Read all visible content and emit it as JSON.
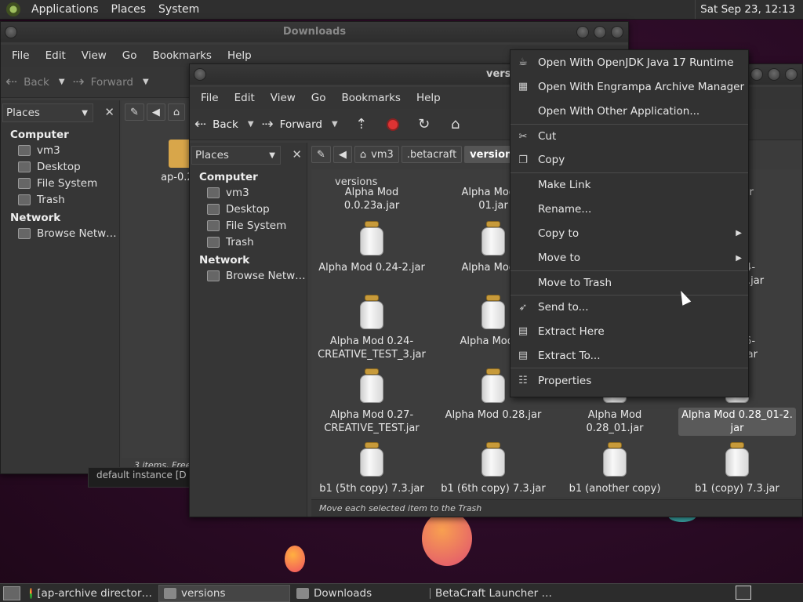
{
  "topbar": {
    "menus": [
      "Applications",
      "Places",
      "System"
    ],
    "clock": "Sat Sep 23, 12:13"
  },
  "back_window": {
    "title": "Downloads",
    "menus": [
      "File",
      "Edit",
      "View",
      "Go",
      "Bookmarks",
      "Help"
    ],
    "back_label": "Back",
    "forward_label": "Forward",
    "places_label": "Places",
    "sidebar": {
      "computer": "Computer",
      "items": [
        "vm3",
        "Desktop",
        "File System",
        "Trash"
      ],
      "network": "Network",
      "net_items": [
        "Browse Netw…"
      ]
    },
    "file": "ap-0.28",
    "status": "3 items, Free s",
    "behind_text": "default instance [D"
  },
  "front_window": {
    "title": "versi",
    "menus": [
      "File",
      "Edit",
      "View",
      "Go",
      "Bookmarks",
      "Help"
    ],
    "back_label": "Back",
    "forward_label": "Forward",
    "places_label": "Places",
    "path": [
      "vm3",
      ".betacraft",
      "versions"
    ],
    "sidebar": {
      "computer": "Computer",
      "items": [
        "vm3",
        "Desktop",
        "File System",
        "Trash"
      ],
      "network": "Network",
      "net_items": [
        "Browse Netw…"
      ]
    },
    "folder_header": "versions",
    "files": [
      {
        "name": "Alpha Mod 0.0.23a.jar"
      },
      {
        "name": "Alpha Mod 0\n01.jar"
      },
      {
        "name": ".24.jar"
      },
      {
        "name": "Alpha Mod 0.24-2.jar"
      },
      {
        "name": "Alpha Mod 0"
      },
      {
        "name": "d 0.24-\nTEST_2.jar"
      },
      {
        "name": "Alpha Mod 0.24-\nCREATIVE_TEST_3.jar"
      },
      {
        "name": "Alpha Mod 0."
      },
      {
        "name": "d 0.26-\nTEST.jar"
      },
      {
        "name": "Alpha Mod 0.27-\nCREATIVE_TEST.jar"
      },
      {
        "name": "Alpha Mod 0.28.jar"
      },
      {
        "name": "Alpha Mod 0.28_01.jar"
      },
      {
        "name": "Alpha Mod 0.28_01-2.\njar"
      },
      {
        "name": "b1 (5th copy) 7.3.jar"
      },
      {
        "name": "b1 (6th copy) 7.3.jar"
      },
      {
        "name": "b1 (another copy) 7.3."
      },
      {
        "name": "b1 (copy) 7.3.jar"
      }
    ],
    "status": "Move each selected item to the Trash"
  },
  "context_menu": {
    "items": [
      {
        "label": "Open With OpenJDK Java 17 Runtime",
        "icon": "java-icon"
      },
      {
        "label": "Open With Engrampa Archive Manager",
        "icon": "archive-icon"
      },
      {
        "label": "Open With Other Application...",
        "icon": ""
      },
      {
        "label": "Cut",
        "icon": "scissors-icon"
      },
      {
        "label": "Copy",
        "icon": "copy-icon"
      },
      {
        "label": "Make Link",
        "icon": ""
      },
      {
        "label": "Rename...",
        "icon": ""
      },
      {
        "label": "Copy to",
        "icon": "",
        "submenu": true
      },
      {
        "label": "Move to",
        "icon": "",
        "submenu": true
      },
      {
        "label": "Move to Trash",
        "icon": ""
      },
      {
        "label": "Send to...",
        "icon": "send-icon"
      },
      {
        "label": "Extract Here",
        "icon": "extract-icon"
      },
      {
        "label": "Extract To...",
        "icon": "extract-icon"
      },
      {
        "label": "Properties",
        "icon": "properties-icon"
      }
    ]
  },
  "taskbar": {
    "tasks": [
      {
        "label": "[ap-archive director…",
        "icon": "chrome-icon"
      },
      {
        "label": "versions",
        "icon": "folder-icon",
        "active": true
      },
      {
        "label": "Downloads",
        "icon": "folder-icon"
      },
      {
        "label": "BetaCraft Launcher …",
        "icon": "app-icon"
      }
    ]
  },
  "colors": {
    "accent": "#5a5a5a",
    "desktop": "#2a0b25"
  }
}
